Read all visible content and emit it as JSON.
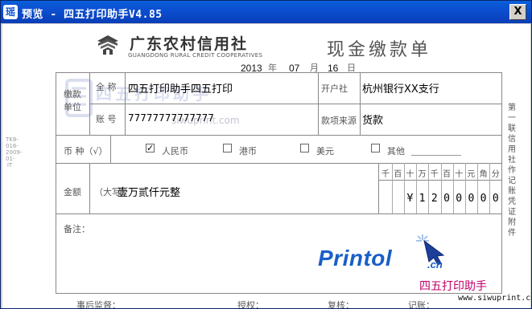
{
  "window": {
    "title": "预览 - 四五打印助手V4.85",
    "app_icon": "瑶",
    "close_label": "X"
  },
  "bank": {
    "name_cn": "广东农村信用社",
    "name_en": "GUANGDONG RURAL CREDIT COOPERATIVES",
    "form_title": "现金缴款单"
  },
  "date": {
    "year": "2013",
    "month": "07",
    "day": "16",
    "year_label": "年",
    "month_label": "月",
    "day_label": "日"
  },
  "payer": {
    "group_label": "缴款单位",
    "name_label": "全 称",
    "name_value": "四五打印助手四五打印",
    "account_label": "账 号",
    "account_value": "77777777777777",
    "bank_label": "开户社",
    "bank_value": "杭州银行XX支行",
    "source_label": "款项来源",
    "source_value": "货款"
  },
  "currency": {
    "label": "币 种（√）",
    "options": [
      {
        "label": "人民币",
        "checked": true
      },
      {
        "label": "港币",
        "checked": false
      },
      {
        "label": "美元",
        "checked": false
      },
      {
        "label": "其他",
        "checked": false
      }
    ]
  },
  "amount": {
    "label": "金额",
    "upper_label": "（大写）",
    "words": "壹万贰仟元整",
    "units": [
      "千",
      "百",
      "十",
      "万",
      "千",
      "百",
      "十",
      "元",
      "角",
      "分"
    ],
    "digits": [
      "",
      "",
      "¥",
      "1",
      "2",
      "0",
      "0",
      "0",
      "0",
      "0"
    ]
  },
  "remarks": {
    "label": "备注："
  },
  "side_note": "第一联 信用社作记账凭证附件",
  "left_code": "TK8-016-2009-01-IT",
  "watermark": {
    "text": "四五打印助手",
    "url": "siwuprint.com"
  },
  "branding": {
    "printol": "Printol",
    "printol_suffix": ".cn",
    "name": "四五打印助手",
    "url": "www.siwuprint.com"
  },
  "footer": {
    "supervisor": "事后监督：",
    "authorize": "授权：",
    "review": "复核：",
    "record": "记账："
  }
}
